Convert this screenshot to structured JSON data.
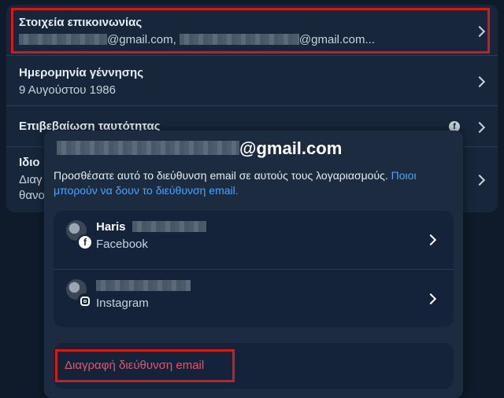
{
  "contact": {
    "title": "Στοιχεία επικοινωνίας",
    "email_suffix_1": "@gmail.com,",
    "email_suffix_2": "@gmail.com..."
  },
  "birthday": {
    "title": "Ημερομηνία γέννησης",
    "value": "9 Αυγούστου 1986"
  },
  "identity": {
    "title": "Επιβεβαίωση ταυτότητας",
    "icon": "facebook-icon"
  },
  "privacy_row": {
    "title_prefix": "Ιδιο",
    "line2_prefix": "Διαγ",
    "line3_prefix": "θανο"
  },
  "overlay": {
    "email_suffix": "@gmail.com",
    "description": "Προσθέσατε αυτό το διεύθυνση email σε αυτούς τους λογαριασμούς.",
    "description_link": "Ποιοι μπορούν να δουν το διεύθυνση email.",
    "accounts": [
      {
        "name": "Haris",
        "platform": "Facebook",
        "badge_icon": "facebook-icon"
      },
      {
        "name": "",
        "platform": "Instagram",
        "badge_icon": "instagram-icon"
      }
    ],
    "delete_label": "Διαγραφή διεύθυνση email"
  },
  "colors": {
    "background": "#0f1b2a",
    "card": "#17263a",
    "link": "#4ea3ff",
    "danger": "#e0566b",
    "highlight": "#d11a1a"
  }
}
